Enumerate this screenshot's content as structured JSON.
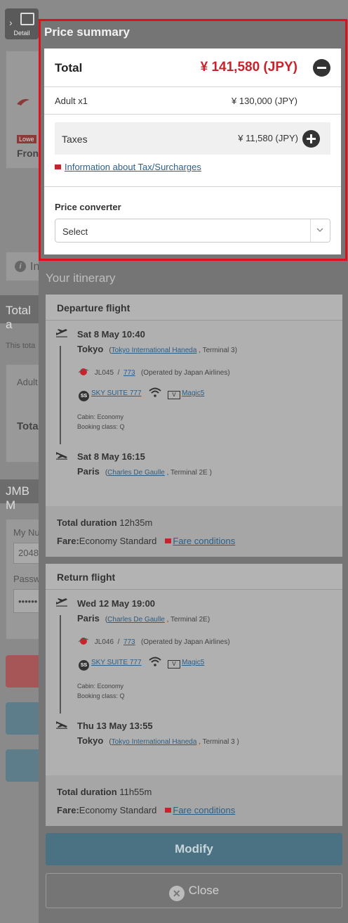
{
  "background": {
    "detail_label": "Detail",
    "lowest_badge": "Lowe",
    "from_text": "Fron",
    "info_text": "In",
    "total_header": "Total a",
    "this_total_text": "This tota",
    "adult_text": "Adult",
    "tota_text": "Tota",
    "jmb_header": "JMB M",
    "my_number_label": "My Nu",
    "my_number_value": "2048",
    "password_label": "Passw",
    "password_value": "••••••"
  },
  "price_summary": {
    "title": "Price summary",
    "total_label": "Total",
    "total_value": "¥ 141,580 (JPY)",
    "adult_label": "Adult x1",
    "adult_value": "¥ 130,000 (JPY)",
    "taxes_label": "Taxes",
    "taxes_value": "¥ 11,580 (JPY)",
    "tax_link": "Information about Tax/Surcharges",
    "converter_label": "Price converter",
    "converter_select": "Select"
  },
  "itinerary": {
    "title": "Your itinerary",
    "departure": {
      "header": "Departure flight",
      "dep_datetime": "Sat 8 May   10:40",
      "dep_city": "Tokyo",
      "dep_airport": "Tokyo International Haneda",
      "dep_terminal": ", Terminal   3)",
      "flight_no": "JL045",
      "aircraft": "773",
      "operated_by": "(Operated by Japan Airlines)",
      "seat": "SKY SUITE 777",
      "entertainment": "Magic5",
      "cabin": "Cabin: Economy",
      "booking_class": "Booking class: Q",
      "arr_datetime": "Sat 8 May   16:15",
      "arr_city": "Paris",
      "arr_airport": "Charles De Gaulle",
      "arr_terminal": ", Terminal    2E )",
      "duration_label": "Total duration",
      "duration_value": "12h35m",
      "fare_label": "Fare:",
      "fare_value": "Economy Standard",
      "fare_link": "Fare conditions"
    },
    "return": {
      "header": "Return flight",
      "dep_datetime": "Wed 12 May   19:00",
      "dep_city": "Paris",
      "dep_airport": "Charles De Gaulle",
      "dep_terminal": ", Terminal  2E)",
      "flight_no": "JL046",
      "aircraft": "773",
      "operated_by": "(Operated by Japan Airlines)",
      "seat": "SKY SUITE 777",
      "entertainment": "Magic5",
      "cabin": "Cabin: Economy",
      "booking_class": "Booking class: Q",
      "arr_datetime": "Thu 13 May   13:55",
      "arr_city": "Tokyo",
      "arr_airport": "Tokyo International Haneda",
      "arr_terminal": ", Terminal    3 )",
      "duration_label": "Total duration",
      "duration_value": "11h55m",
      "fare_label": "Fare:",
      "fare_value": "Economy Standard",
      "fare_link": "Fare conditions"
    }
  },
  "actions": {
    "modify": "Modify",
    "close": "Close"
  },
  "colors": {
    "price_red": "#c8232c",
    "highlight_outline": "#e0101b",
    "modify_bg": "#4a7282",
    "link": "#2b5f8a"
  }
}
